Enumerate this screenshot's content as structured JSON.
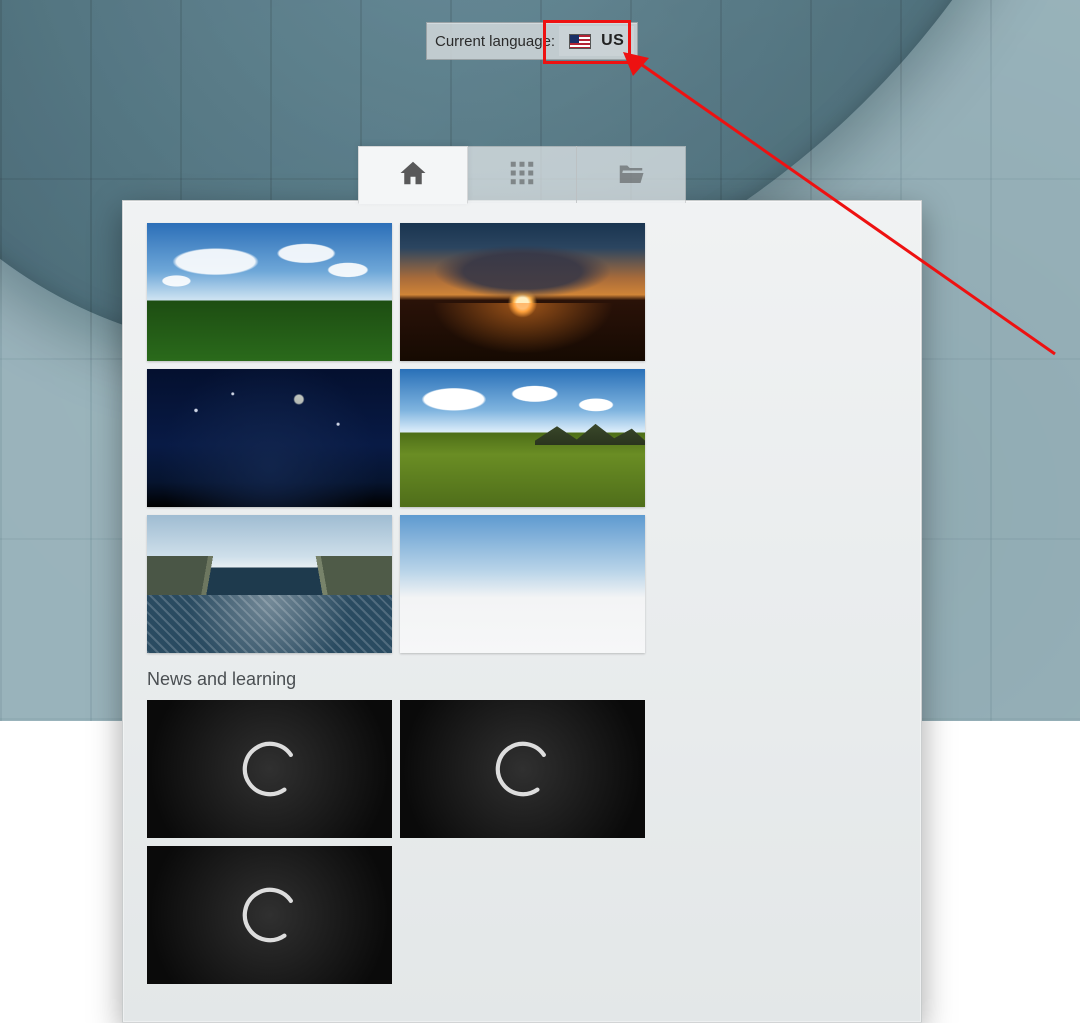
{
  "language_bar": {
    "label": "Current language:",
    "code": "US",
    "flag_name": "us-flag-icon"
  },
  "annotation": {
    "highlight_target": "language selector"
  },
  "tabs": {
    "active_index": 0,
    "items": [
      {
        "name": "tab-home",
        "icon": "home-icon"
      },
      {
        "name": "tab-gallery",
        "icon": "grid-icon"
      },
      {
        "name": "tab-open",
        "icon": "folder-open-icon"
      }
    ]
  },
  "sections": {
    "presets_title": "",
    "news_title": "News and learning"
  },
  "scene_presets": [
    {
      "name": "preset-day-field",
      "style_key": "t-day"
    },
    {
      "name": "preset-sunset",
      "style_key": "t-sunset"
    },
    {
      "name": "preset-night",
      "style_key": "t-night"
    },
    {
      "name": "preset-grass-hills",
      "style_key": "t-grass"
    },
    {
      "name": "preset-mountain-lake",
      "style_key": "t-lake"
    },
    {
      "name": "preset-empty-sky",
      "style_key": "t-empty"
    }
  ],
  "news_tiles": [
    {
      "name": "news-tile-1",
      "state": "loading"
    },
    {
      "name": "news-tile-2",
      "state": "loading"
    },
    {
      "name": "news-tile-3",
      "state": "loading"
    }
  ],
  "colors": {
    "annotation_red": "#ee1111",
    "panel_bg": "#f0f2f3"
  }
}
